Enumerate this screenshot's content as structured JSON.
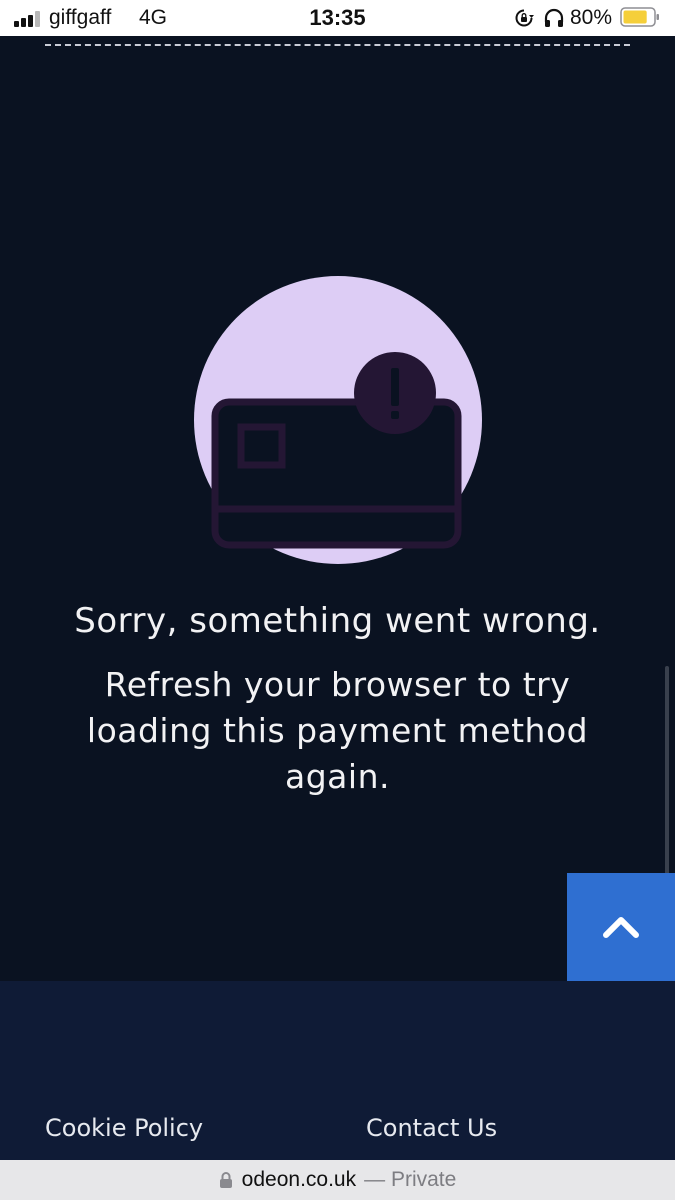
{
  "status_bar": {
    "carrier": "giffgaff",
    "network": "4G",
    "time": "13:35",
    "battery_percent": "80%",
    "battery_level": 0.8,
    "icons": [
      "signal-icon",
      "rotation-lock-icon",
      "headphones-icon",
      "battery-icon"
    ]
  },
  "error": {
    "title": "Sorry, something went wrong.",
    "message": "Refresh your browser to try loading this payment method again.",
    "illustration_icon": "card-error-icon"
  },
  "back_to_top": {
    "icon": "chevron-up-icon"
  },
  "footer": {
    "links": [
      "Cookie Policy",
      "Contact Us"
    ]
  },
  "browser": {
    "domain": "odeon.co.uk",
    "private_label": "— Private"
  },
  "colors": {
    "page_background": "#0a1221",
    "footer_background": "#0f1b36",
    "accent_blue": "#2f6fd1",
    "illustration_circle": "#ddcdf5",
    "illustration_stroke": "#241634",
    "battery_fill": "#f5cf3a"
  }
}
